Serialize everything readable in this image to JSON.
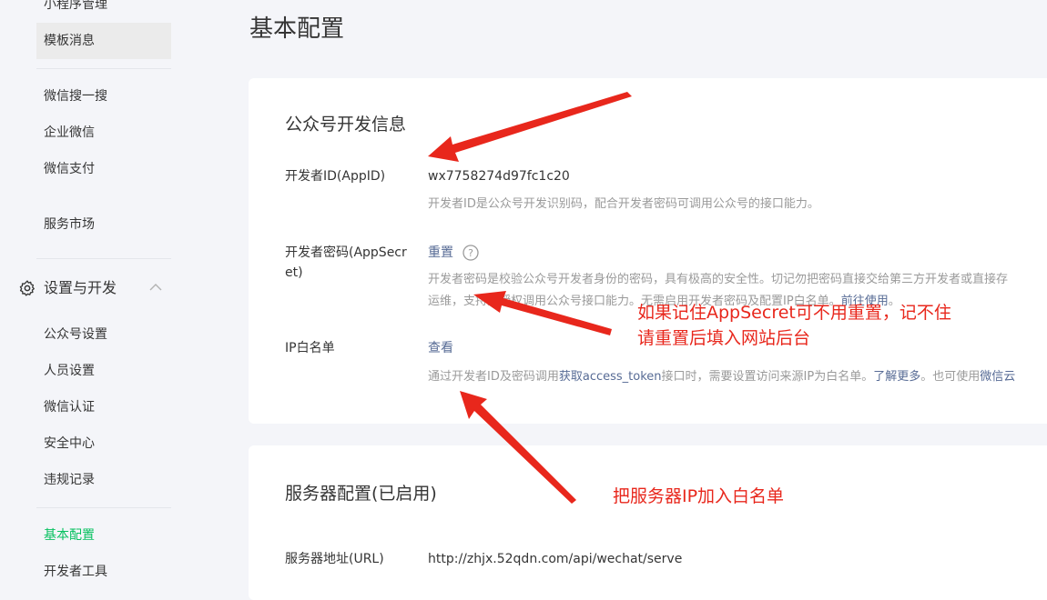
{
  "sidebar": {
    "items_top": [
      "小程序管理",
      "模板消息"
    ],
    "items_mid": [
      "微信搜一搜",
      "企业微信",
      "微信支付",
      "服务市场"
    ],
    "group_label": "设置与开发",
    "group_items": [
      "公众号设置",
      "人员设置",
      "微信认证",
      "安全中心",
      "违规记录"
    ],
    "items_bottom": [
      "基本配置",
      "开发者工具"
    ]
  },
  "page": {
    "title": "基本配置"
  },
  "dev_info": {
    "title": "公众号开发信息",
    "appid_label": "开发者ID(AppID)",
    "appid_value": "wx7758274d97fc1c20",
    "appid_desc": "开发者ID是公众号开发识别码，配合开发者密码可调用公众号的接口能力。",
    "secret_label": "开发者密码(AppSecret)",
    "secret_action": "重置",
    "secret_desc_1": "开发者密码是校验公众号开发者身份的密码，具有极高的安全性。切记勿把密码直接交给第三方开发者或直接存",
    "secret_desc_2a": "运维，支持免授权调用公众号接口能力。无需启用开发者密码及配置IP白名单。",
    "secret_desc_2b": "前往使用",
    "secret_desc_2c": "。",
    "ip_label": "IP白名单",
    "ip_action": "查看",
    "ip_desc_a": "通过开发者ID及密码调用",
    "ip_desc_b": "获取access_token",
    "ip_desc_c": "接口时，需要设置访问来源IP为白名单。",
    "ip_desc_d": "了解更多",
    "ip_desc_e": "。也可使用",
    "ip_desc_f": "微信云"
  },
  "server_config": {
    "title": "服务器配置(已启用)",
    "url_label": "服务器地址(URL)",
    "url_value": "http://zhjx.52qdn.com/api/wechat/serve"
  },
  "annotations": {
    "note_secret_1": "如果记住AppSecret可不用重置，记不住",
    "note_secret_2": "请重置后填入网站后台",
    "note_ip": "把服务器IP加入白名单"
  },
  "colors": {
    "accent": "#07c160",
    "link": "#576b95",
    "annotation": "#e8271c"
  }
}
